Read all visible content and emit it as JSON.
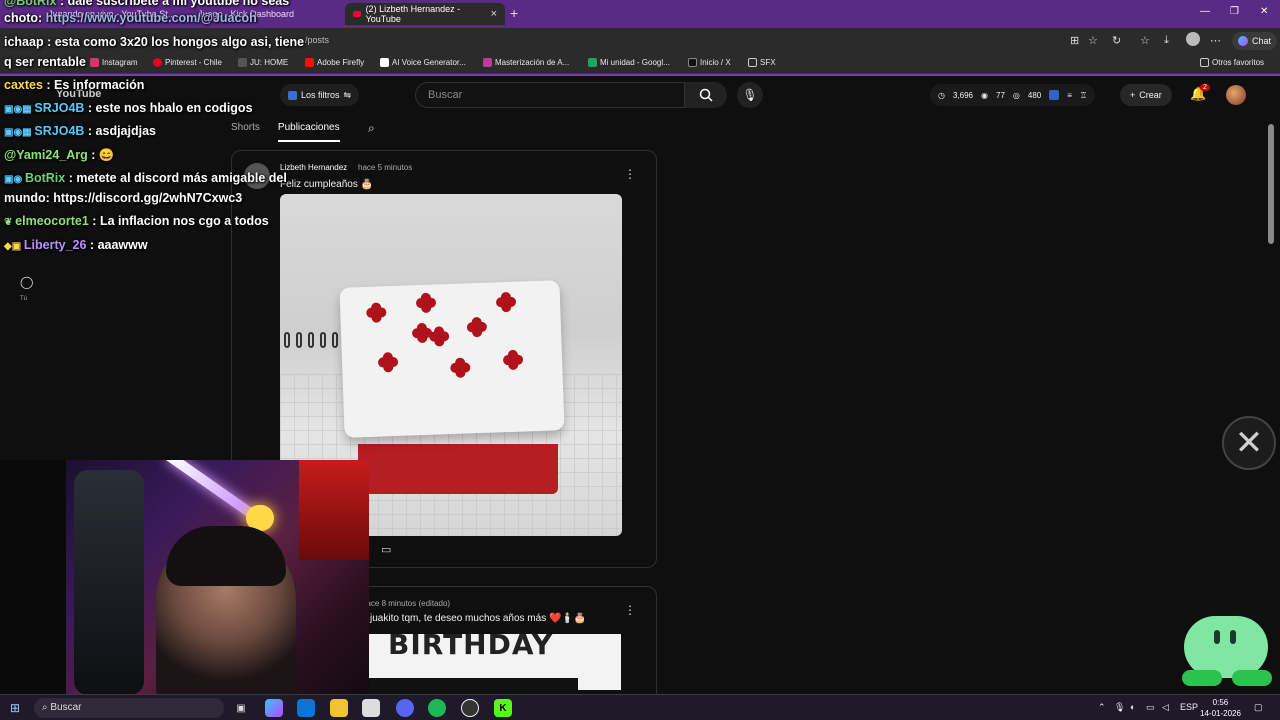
{
  "browser": {
    "tabs": [
      {
        "label": "Jugando en vivo - YouTube St...",
        "active": false
      },
      {
        "label": "Juego - Kick Dashboard",
        "active": false
      },
      {
        "label": "(2) Lizbeth Hernandez - YouTube",
        "active": true
      }
    ],
    "url": "/posts",
    "chat_label": "Chat",
    "bookmarks": [
      "Instagram",
      "Pinterest - Chile",
      "JU: HOME",
      "Adobe Firefly",
      "AI Voice Generator...",
      "Masterización de A...",
      "Mi unidad - Googl...",
      "Inicio / X",
      "SFX"
    ],
    "other_favorites": "Otros favoritos"
  },
  "youtube": {
    "logo_text": "YouTube",
    "filters_label": "Los filtros",
    "search_placeholder": "Buscar",
    "stats": {
      "views": "3,696",
      "watching": "77",
      "subs": "480"
    },
    "create_label": "Crear",
    "notif_count": "2",
    "tabs": [
      "Shorts",
      "Publicaciones"
    ],
    "side_label": "Tú",
    "posts": [
      {
        "author": "Lizbeth Hernandez",
        "time": "hace 5 minutos",
        "text": "Feliz cumpleaños 🎂"
      },
      {
        "time": "hace 8 minutos (editado)",
        "text": "juakito tqm, te deseo muchos años más ❤️🕯️🎂",
        "image_text": "BIRTHDAY"
      }
    ]
  },
  "chat": [
    {
      "user": "@BotRix",
      "text": "dale suscribete a mi youtube no seas",
      "color": "#6fd16f"
    },
    {
      "user": "",
      "text": "choto: ",
      "link": "https://www.youtube.com/@Juacoh",
      "color": "#ffffff"
    },
    {
      "user": "ichaap",
      "text": "esta como 3x20 los hongos algo asi, tiene",
      "color": "#ffffff"
    },
    {
      "user": "",
      "text": "q ser rentable",
      "color": "#ffffff"
    },
    {
      "user": "caxtes",
      "text": "Es información",
      "color": "#ffd84a"
    },
    {
      "user": "SRJO4B",
      "text": "este nos hbalo en codigos",
      "color": "#5ac8fa"
    },
    {
      "user": "SRJO4B",
      "text": "asdjajdjas",
      "color": "#5ac8fa"
    },
    {
      "user": "@Yami24_Arg",
      "text": "😄",
      "color": "#8fe07a"
    },
    {
      "user": "BotRix",
      "text": "metete al discord más amigable del",
      "color": "#6fd16f"
    },
    {
      "user": "",
      "text": "mundo: https://discord.gg/2whN7Cxwc3",
      "color": "#ffffff"
    },
    {
      "user": "elmeocorte1",
      "text": "La inflacion nos cgo a todos",
      "color": "#8fe07a"
    },
    {
      "user": "Liberty_26",
      "text": "aaawww",
      "color": "#b890ff"
    }
  ],
  "taskbar": {
    "search_label": "Buscar",
    "lang": "ESP",
    "time": "0:56",
    "date": "14-01-2026"
  }
}
